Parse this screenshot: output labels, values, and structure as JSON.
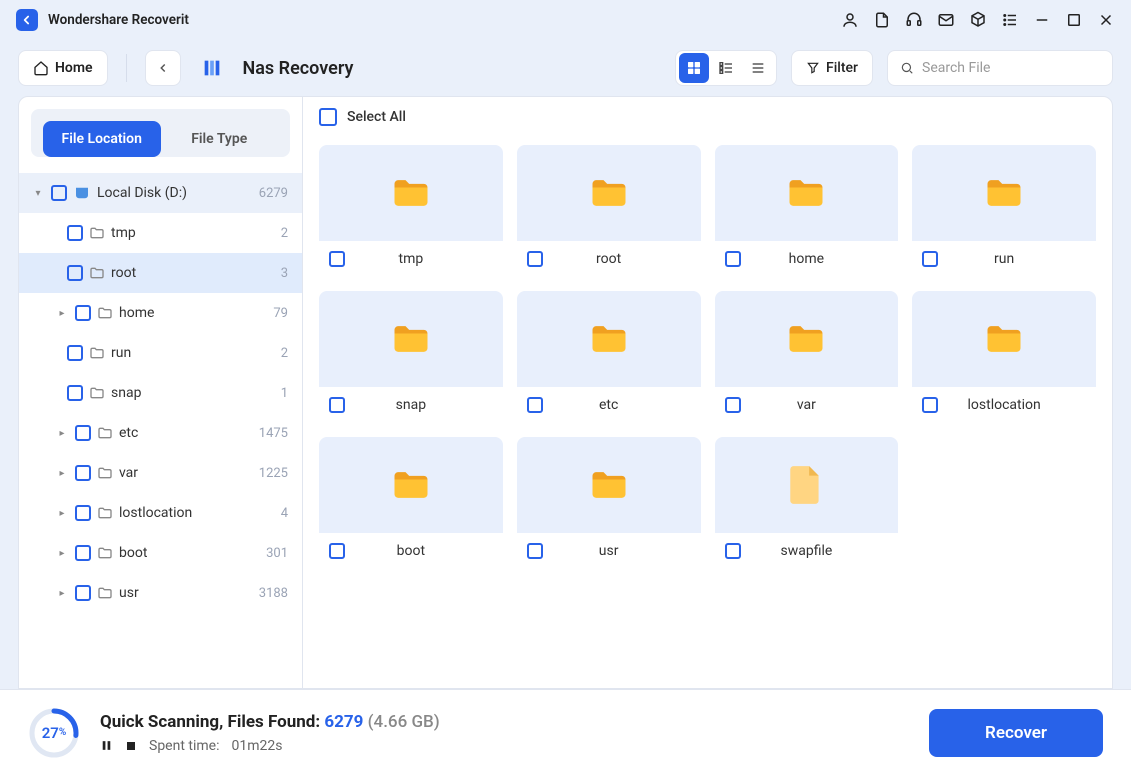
{
  "app": {
    "title": "Wondershare Recoverit"
  },
  "toolbar": {
    "home_label": "Home",
    "breadcrumb": "Nas Recovery",
    "filter_label": "Filter",
    "search_placeholder": "Search File"
  },
  "sidebar": {
    "tabs": {
      "location": "File Location",
      "type": "File Type"
    },
    "disk": {
      "name": "Local Disk (D:)",
      "count": "6279"
    },
    "items": [
      {
        "name": "tmp",
        "count": "2",
        "expand": false
      },
      {
        "name": "root",
        "count": "3",
        "expand": false,
        "selected": true
      },
      {
        "name": "home",
        "count": "79",
        "expand": true
      },
      {
        "name": "run",
        "count": "2",
        "expand": false
      },
      {
        "name": "snap",
        "count": "1",
        "expand": false
      },
      {
        "name": "etc",
        "count": "1475",
        "expand": true
      },
      {
        "name": "var",
        "count": "1225",
        "expand": true
      },
      {
        "name": "lostlocation",
        "count": "4",
        "expand": true
      },
      {
        "name": "boot",
        "count": "301",
        "expand": true
      },
      {
        "name": "usr",
        "count": "3188",
        "expand": true
      }
    ]
  },
  "grid": {
    "select_all_label": "Select All",
    "tiles": [
      {
        "name": "tmp",
        "type": "folder"
      },
      {
        "name": "root",
        "type": "folder"
      },
      {
        "name": "home",
        "type": "folder"
      },
      {
        "name": "run",
        "type": "folder"
      },
      {
        "name": "snap",
        "type": "folder"
      },
      {
        "name": "etc",
        "type": "folder"
      },
      {
        "name": "var",
        "type": "folder"
      },
      {
        "name": "lostlocation",
        "type": "folder"
      },
      {
        "name": "boot",
        "type": "folder"
      },
      {
        "name": "usr",
        "type": "folder"
      },
      {
        "name": "swapfile",
        "type": "file"
      }
    ]
  },
  "status": {
    "percent": "27",
    "percent_suffix": "%",
    "title_prefix": "Quick Scanning, Files Found: ",
    "found": "6279",
    "size": "(4.66 GB)",
    "spent_label": "Spent time:",
    "spent_value": "01m22s",
    "recover_label": "Recover"
  }
}
